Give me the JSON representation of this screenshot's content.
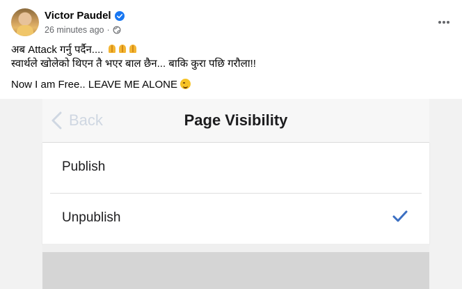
{
  "post": {
    "author": "Victor Paudel",
    "verified": true,
    "timestamp": "26 minutes ago",
    "separator": "·",
    "privacy_icon": "globe-icon",
    "line1": "अब Attack गर्नु पर्दैन....",
    "line2": "स्वार्थले खोलेको थिएन तै भएर बाल छैन... बाकि कुरा पछि गरौला!!",
    "line3": "Now I am Free.. LEAVE ME ALONE"
  },
  "screenshot": {
    "back_label": "Back",
    "title": "Page Visibility",
    "options": [
      {
        "label": "Publish",
        "selected": false
      },
      {
        "label": "Unpublish",
        "selected": true
      }
    ],
    "check_color": "#3b6fc2"
  },
  "colors": {
    "verified": "#1877f2",
    "muted": "#65676b"
  }
}
